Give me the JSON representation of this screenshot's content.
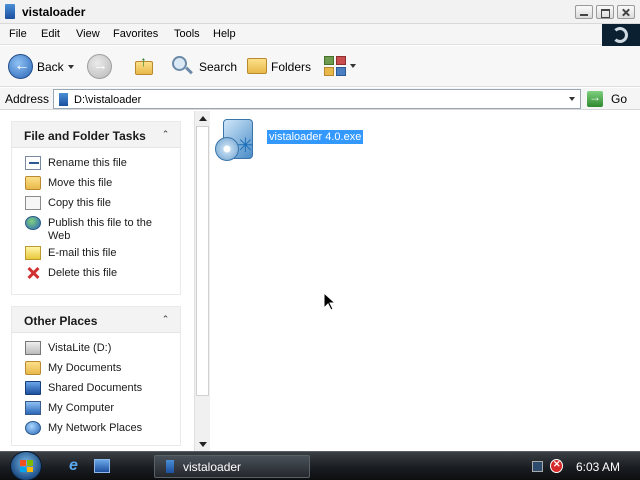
{
  "window": {
    "title": "vistaloader"
  },
  "menubar": {
    "items": [
      "File",
      "Edit",
      "View",
      "Favorites",
      "Tools",
      "Help"
    ]
  },
  "toolbar": {
    "back_label": "Back",
    "search_label": "Search",
    "folders_label": "Folders"
  },
  "address": {
    "label": "Address",
    "value": "D:\\vistaloader",
    "go_label": "Go"
  },
  "file_tasks": {
    "title": "File and Folder Tasks",
    "items": [
      {
        "label": "Rename this file",
        "icon": "rename-icon"
      },
      {
        "label": "Move this file",
        "icon": "move-icon"
      },
      {
        "label": "Copy this file",
        "icon": "copy-icon"
      },
      {
        "label": "Publish this file to the Web",
        "icon": "publish-web-icon"
      },
      {
        "label": "E-mail this file",
        "icon": "email-icon"
      },
      {
        "label": "Delete this file",
        "icon": "delete-icon"
      }
    ]
  },
  "other_places": {
    "title": "Other Places",
    "items": [
      {
        "label": "VistaLite (D:)",
        "icon": "drive-icon"
      },
      {
        "label": "My Documents",
        "icon": "documents-icon"
      },
      {
        "label": "Shared Documents",
        "icon": "shared-documents-icon"
      },
      {
        "label": "My Computer",
        "icon": "computer-icon"
      },
      {
        "label": "My Network Places",
        "icon": "network-icon"
      }
    ]
  },
  "files": [
    {
      "name": "vistaloader 4.0.exe",
      "selected": true,
      "icon": "installer-icon"
    }
  ],
  "taskbar": {
    "task_label": "vistaloader",
    "clock": "6:03 AM"
  },
  "colors": {
    "selection": "#3399ff",
    "taskbar": "#1a1d21"
  }
}
